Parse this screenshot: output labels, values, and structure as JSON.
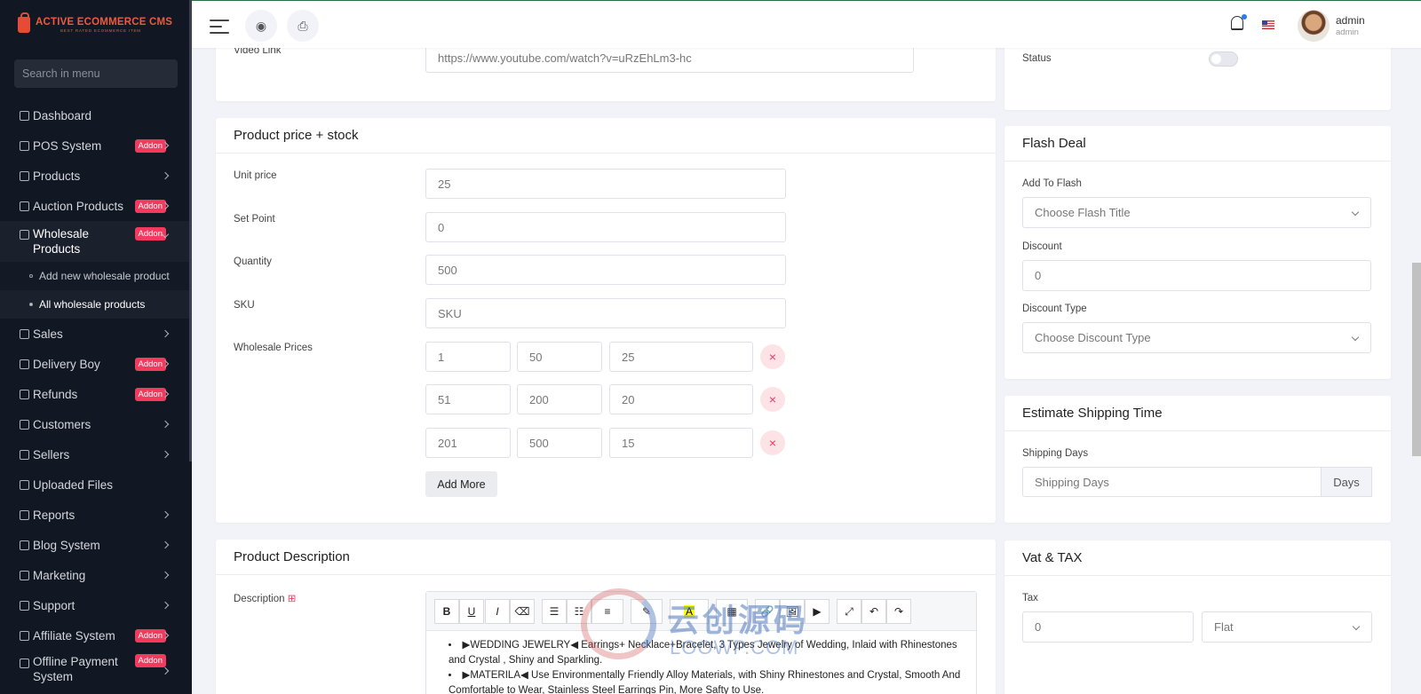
{
  "sidebar": {
    "logo_title": "ACTIVE ECOMMERCE CMS",
    "logo_subtitle": "BEST RATED ECOMMERCE ITEM",
    "search_placeholder": "Search in menu",
    "items": [
      {
        "label": "Dashboard",
        "icon": "dashboard-icon"
      },
      {
        "label": "POS System",
        "badge": "Addon",
        "icon": "pos-icon"
      },
      {
        "label": "Products",
        "icon": "cart-icon"
      },
      {
        "label": "Auction Products",
        "badge": "Addon",
        "icon": "gavel-icon"
      },
      {
        "label": "Wholesale Products",
        "badge": "Addon",
        "icon": "wholesale-icon"
      },
      {
        "label": "Sales",
        "icon": "money-icon"
      },
      {
        "label": "Delivery Boy",
        "badge": "Addon",
        "icon": "truck-icon"
      },
      {
        "label": "Refunds",
        "badge": "Addon",
        "icon": "refund-icon"
      },
      {
        "label": "Customers",
        "icon": "users-icon"
      },
      {
        "label": "Sellers",
        "icon": "user-icon"
      },
      {
        "label": "Uploaded Files",
        "icon": "folder-icon"
      },
      {
        "label": "Reports",
        "icon": "file-icon"
      },
      {
        "label": "Blog System",
        "icon": "blog-icon"
      },
      {
        "label": "Marketing",
        "icon": "bullhorn-icon"
      },
      {
        "label": "Support",
        "icon": "link-icon"
      },
      {
        "label": "Affiliate System",
        "badge": "Addon",
        "icon": "affiliate-icon"
      },
      {
        "label": "Offline Payment System",
        "badge": "Addon",
        "icon": "money-bill-icon"
      }
    ],
    "wholesale_sub": [
      "Add new wholesale product",
      "All wholesale products"
    ]
  },
  "topbar": {
    "user_name": "admin",
    "user_role": "admin"
  },
  "video": {
    "label": "Video Link",
    "value": "https://www.youtube.com/watch?v=uRzEhLm3-hc"
  },
  "status": {
    "label": "Status",
    "on": false
  },
  "price_stock": {
    "title": "Product price + stock",
    "unit_price_label": "Unit price",
    "unit_price": "25",
    "set_point_label": "Set Point",
    "set_point": "0",
    "quantity_label": "Quantity",
    "quantity": "500",
    "sku_label": "SKU",
    "sku_placeholder": "SKU",
    "wholesale_label": "Wholesale Prices",
    "wholesale_rows": [
      [
        "1",
        "50",
        "25"
      ],
      [
        "51",
        "200",
        "20"
      ],
      [
        "201",
        "500",
        "15"
      ]
    ],
    "add_more": "Add More",
    "remove_glyph": "×"
  },
  "flash_deal": {
    "title": "Flash Deal",
    "add_label": "Add To Flash",
    "add_placeholder": "Choose Flash Title",
    "discount_label": "Discount",
    "discount": "0",
    "type_label": "Discount Type",
    "type_placeholder": "Choose Discount Type"
  },
  "shipping": {
    "title": "Estimate Shipping Time",
    "days_label": "Shipping Days",
    "days_placeholder": "Shipping Days",
    "unit": "Days"
  },
  "description": {
    "title": "Product Description",
    "label": "Description",
    "bullets": [
      "▶WEDDING JEWELRY◀ Earrings+ Necklace+Bracelet, 3 Types Jewelry of Wedding, Inlaid with Rhinestones and Crystal , Shiny and Sparkling.",
      "▶MATERILA◀ Use Environmentally Friendly Alloy Materials, with Shiny Rhinestones and Crystal, Smooth And Comfortable to Wear, Stainless Steel Earrings Pin, More Safty to Use."
    ],
    "toolbar": [
      "B",
      "U",
      "I",
      "⌫",
      "☰",
      "☷",
      "≡",
      "✎",
      "A",
      "▦",
      "🔗",
      "🖼",
      "▶",
      "⤢",
      "↶",
      "↷"
    ]
  },
  "vat": {
    "title": "Vat & TAX",
    "tax_label": "Tax",
    "tax": "0",
    "tax_type": "Flat"
  },
  "watermark": {
    "text": "云创源码",
    "sub": "LOOWP.COM"
  }
}
